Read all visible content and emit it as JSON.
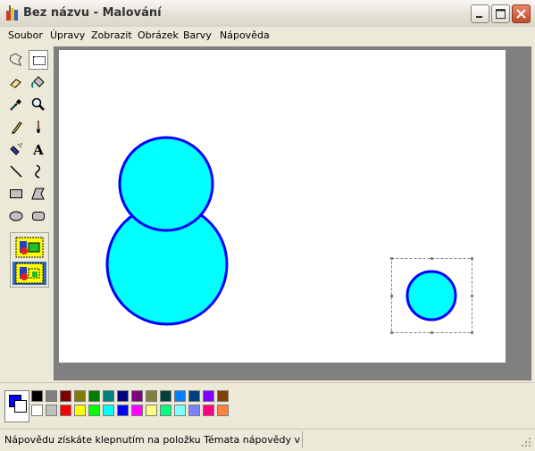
{
  "window": {
    "title": "Bez názvu - Malování"
  },
  "title_buttons": [
    "minimize-icon",
    "maximize-icon",
    "close-icon"
  ],
  "menu": {
    "items": [
      {
        "id": "file",
        "label": "Soubor"
      },
      {
        "id": "edit",
        "label": "Úpravy"
      },
      {
        "id": "view",
        "label": "Zobrazit"
      },
      {
        "id": "image",
        "label": "Obrázek"
      },
      {
        "id": "colors",
        "label": "Barvy"
      },
      {
        "id": "help",
        "label": "Nápověda"
      }
    ]
  },
  "tools": {
    "selected": "select-rectangle",
    "items": [
      {
        "id": "free-form-select",
        "icon": "free-form-select-icon"
      },
      {
        "id": "select-rectangle",
        "icon": "select-rectangle-icon"
      },
      {
        "id": "eraser",
        "icon": "eraser-icon"
      },
      {
        "id": "fill",
        "icon": "fill-bucket-icon"
      },
      {
        "id": "pick-color",
        "icon": "eyedropper-icon"
      },
      {
        "id": "magnifier",
        "icon": "magnifier-icon"
      },
      {
        "id": "pencil",
        "icon": "pencil-icon"
      },
      {
        "id": "brush",
        "icon": "brush-icon"
      },
      {
        "id": "airbrush",
        "icon": "airbrush-icon"
      },
      {
        "id": "text",
        "icon": "text-icon"
      },
      {
        "id": "line",
        "icon": "line-icon"
      },
      {
        "id": "curve",
        "icon": "curve-icon"
      },
      {
        "id": "rectangle",
        "icon": "rectangle-icon"
      },
      {
        "id": "polygon",
        "icon": "polygon-icon"
      },
      {
        "id": "ellipse",
        "icon": "ellipse-icon"
      },
      {
        "id": "rounded-rectangle",
        "icon": "rounded-rectangle-icon"
      }
    ],
    "text_tool_glyph": "A",
    "transparency_options": [
      "opaque-selection",
      "transparent-selection"
    ],
    "transparency_selected": "transparent-selection"
  },
  "canvas": {
    "shapes": [
      {
        "type": "circle",
        "name": "large-circle",
        "fill": "#00ffff",
        "stroke": "#0000ff"
      },
      {
        "type": "circle",
        "name": "top-circle",
        "fill": "#00ffff",
        "stroke": "#0000ff"
      },
      {
        "type": "circle",
        "name": "small-selected-circle",
        "fill": "#00ffff",
        "stroke": "#0000ff",
        "selected": true
      }
    ]
  },
  "colors": {
    "foreground": "#0000ff",
    "background": "#ffffff",
    "palette_row1": [
      "#000000",
      "#808080",
      "#800000",
      "#808000",
      "#008000",
      "#008080",
      "#000080",
      "#800080",
      "#808040",
      "#004040",
      "#0080ff",
      "#004080",
      "#8000ff",
      "#804000"
    ],
    "palette_row2": [
      "#ffffff",
      "#c0c0c0",
      "#ff0000",
      "#ffff00",
      "#00ff00",
      "#00ffff",
      "#0000ff",
      "#ff00ff",
      "#ffff80",
      "#00ff80",
      "#80ffff",
      "#8080ff",
      "#ff0080",
      "#ff8040"
    ]
  },
  "status": {
    "text": "Nápovědu získáte klepnutím na položku Témata nápovědy v nabídce N"
  }
}
